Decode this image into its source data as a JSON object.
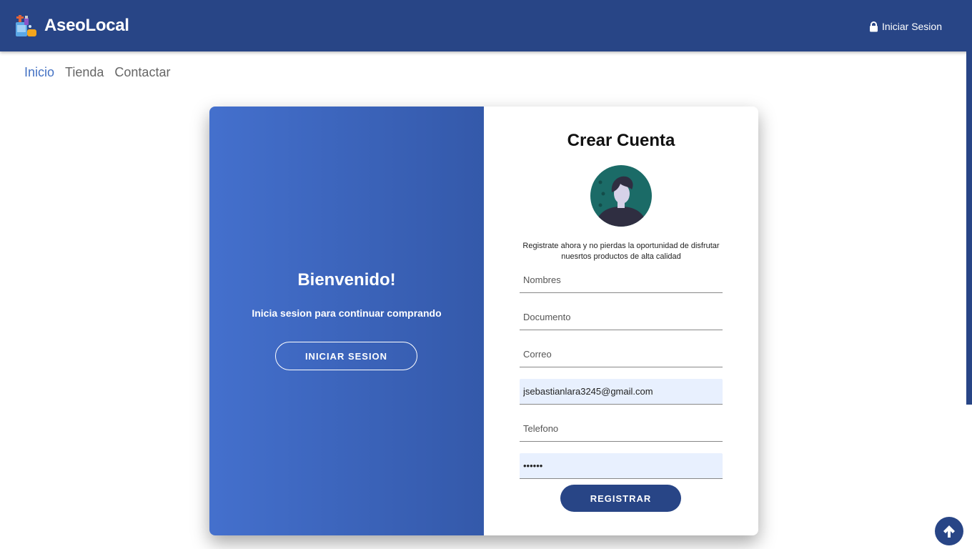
{
  "header": {
    "brand": "AseoLocal",
    "login_label": "Iniciar Sesion",
    "login_icon": "lock-icon",
    "logo_icon": "cleaning-supplies-icon"
  },
  "nav": {
    "items": [
      {
        "label": "Inicio",
        "active": true
      },
      {
        "label": "Tienda",
        "active": false
      },
      {
        "label": "Contactar",
        "active": false
      }
    ]
  },
  "welcome": {
    "title": "Bienvenido!",
    "subtitle": "Inicia sesion para continuar comprando",
    "button_label": "INICIAR SESION"
  },
  "register": {
    "title": "Crear Cuenta",
    "avatar_icon": "user-avatar-icon",
    "description": "Registrate ahora y no pierdas la oportunidad de disfrutar nuesrtos productos de alta calidad",
    "fields": {
      "nombres": {
        "placeholder": "Nombres",
        "value": ""
      },
      "documento": {
        "placeholder": "Documento",
        "value": ""
      },
      "correo": {
        "placeholder": "Correo",
        "value": ""
      },
      "email_autofill": {
        "placeholder": "",
        "value": "jsebastianlara3245@gmail.com"
      },
      "telefono": {
        "placeholder": "Telefono",
        "value": ""
      },
      "password": {
        "placeholder": "",
        "value": "••••••"
      }
    },
    "submit_label": "REGISTRAR"
  },
  "scroll_top_icon": "arrow-up-icon",
  "colors": {
    "primary": "#284586",
    "accent": "#4472c4",
    "panel_gradient_start": "#4470cd",
    "panel_gradient_end": "#3459aa",
    "autofill": "#e8f0fe"
  }
}
